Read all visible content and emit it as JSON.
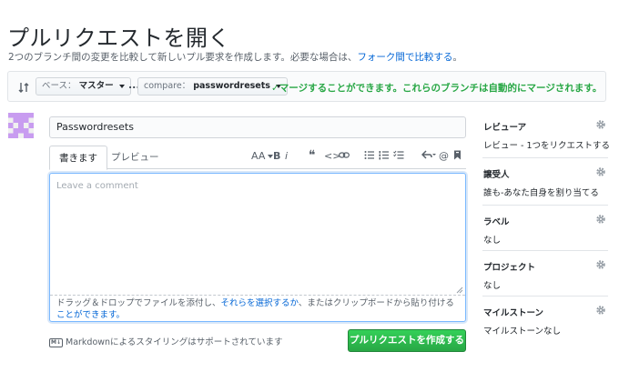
{
  "page": {
    "title": "プルリクエストを開く",
    "subtitle_prefix": "2つのブランチ間の変更を比較して新しいプル要求を作成します。必要な場合は、",
    "subtitle_link": "フォーク間で比較する",
    "subtitle_suffix": "。"
  },
  "compare_bar": {
    "base_label": "ベース：",
    "base_value": "マスター",
    "dots": "...",
    "compare_label": "compare：",
    "compare_value": "passwordresets",
    "merge_status": "✓マージすることができます。これらのブランチは自動的にマージされます。"
  },
  "form": {
    "title_value": "Passwordresets",
    "tab_write": "書きます",
    "tab_preview": "プレビュー",
    "toolbar": {
      "header": "AA",
      "bold": "B",
      "italic": "i",
      "quote": "❝",
      "code": "<>",
      "mention": "@"
    },
    "comment_placeholder": "Leave a comment",
    "drop_hint_prefix": "ドラッグ＆ドロップでファイルを添付し、",
    "drop_hint_link1": "それらを選択するか",
    "drop_hint_middle": "、またはクリップボードから貼り付ける",
    "drop_hint_link2": "ことができます。",
    "markdown_badge": "M↓",
    "markdown_note": "Markdownによるスタイリングはサポートされています",
    "submit_label": "プルリクエストを作成する"
  },
  "sidebar": {
    "sections": [
      {
        "heading": "レビューア",
        "value": "レビュー - 1つをリクエストする"
      },
      {
        "heading": "譲受人",
        "value": "誰も-あなた自身を割り当てる"
      },
      {
        "heading": "ラベル",
        "value": "なし"
      },
      {
        "heading": "プロジェクト",
        "value": "なし"
      },
      {
        "heading": "マイルストーン",
        "value": "マイルストーンなし"
      }
    ]
  },
  "colors": {
    "link": "#0366d6",
    "success": "#28a745",
    "avatar": "#c89cf0"
  }
}
